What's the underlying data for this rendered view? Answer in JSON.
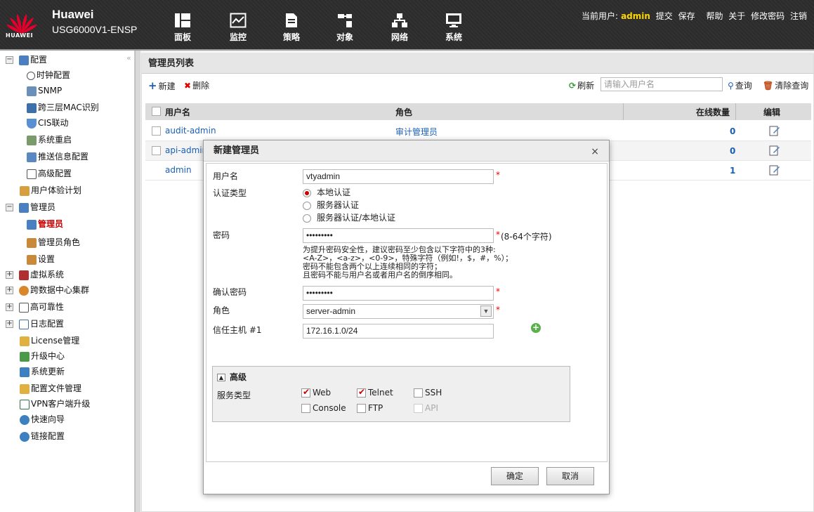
{
  "header": {
    "brand_name": "Huawei",
    "device_name": "USG6000V1-ENSP",
    "logo_text": "HUAWEI",
    "nav": [
      {
        "label": "面板",
        "icon": "dashboard-icon"
      },
      {
        "label": "监控",
        "icon": "monitor-chart-icon"
      },
      {
        "label": "策略",
        "icon": "policy-document-icon"
      },
      {
        "label": "对象",
        "icon": "object-icon"
      },
      {
        "label": "网络",
        "icon": "network-topology-icon"
      },
      {
        "label": "系统",
        "icon": "system-monitor-icon"
      }
    ],
    "active_nav": "系统",
    "current_user_label": "当前用户:",
    "current_user": "admin",
    "links": [
      "提交",
      "保存",
      "帮助",
      "关于",
      "修改密码",
      "注销"
    ]
  },
  "sidebar": {
    "items": [
      {
        "label": "配置",
        "toggle": "−"
      },
      {
        "label": "时钟配置"
      },
      {
        "label": "SNMP"
      },
      {
        "label": "跨三层MAC识别"
      },
      {
        "label": "CIS联动"
      },
      {
        "label": "系统重启"
      },
      {
        "label": "推送信息配置"
      },
      {
        "label": "高级配置"
      },
      {
        "label": "用户体验计划"
      },
      {
        "label": "管理员",
        "toggle": "−"
      },
      {
        "label": "管理员",
        "selected": true
      },
      {
        "label": "管理员角色"
      },
      {
        "label": "设置"
      },
      {
        "label": "虚拟系统",
        "toggle": "+"
      },
      {
        "label": "跨数据中心集群",
        "toggle": "+"
      },
      {
        "label": "高可靠性",
        "toggle": "+"
      },
      {
        "label": "日志配置",
        "toggle": "+"
      },
      {
        "label": "License管理"
      },
      {
        "label": "升级中心"
      },
      {
        "label": "系统更新"
      },
      {
        "label": "配置文件管理"
      },
      {
        "label": "VPN客户端升级"
      },
      {
        "label": "快速向导"
      },
      {
        "label": "链接配置"
      }
    ]
  },
  "main": {
    "title": "管理员列表",
    "toolbar": {
      "new_label": "新建",
      "delete_label": "删除",
      "refresh_label": "刷新",
      "search_placeholder": "请输入用户名",
      "query_label": "查询",
      "clear_label": "清除查询"
    },
    "columns": [
      "用户名",
      "角色",
      "在线数量",
      "编辑"
    ],
    "rows": [
      {
        "username": "audit-admin",
        "role": "审计管理员",
        "online": "0",
        "checkbox": true
      },
      {
        "username": "api-admin",
        "role": "",
        "online": "0",
        "checkbox": true
      },
      {
        "username": "admin",
        "role": "",
        "online": "1",
        "checkbox": false
      }
    ]
  },
  "dialog": {
    "title": "新建管理员",
    "close": "×",
    "username_label": "用户名",
    "username_value": "vtyadmin",
    "auth_label": "认证类型",
    "auth_options": [
      "本地认证",
      "服务器认证",
      "服务器认证/本地认证"
    ],
    "auth_selected": "本地认证",
    "password_label": "密码",
    "password_value": "•••••••••",
    "password_hint": "(8-64个字符)",
    "hint_lines": [
      "为提升密码安全性，建议密码至少包含以下字符中的3种:",
      "<A-Z>，<a-z>，<0-9>，特殊字符（例如!，$，#，%）；",
      "密码不能包含两个以上连续相同的字符；",
      "且密码不能与用户名或者用户名的倒序相同。"
    ],
    "confirm_label": "确认密码",
    "confirm_value": "•••••••••",
    "role_label": "角色",
    "role_value": "server-admin",
    "trust_label": "信任主机 #1",
    "trust_value": "172.16.1.0/24",
    "required_mark": "*",
    "advanced": {
      "label": "高级",
      "service_label": "服务类型",
      "services": [
        {
          "name": "Web",
          "checked": true,
          "disabled": false
        },
        {
          "name": "Telnet",
          "checked": true,
          "disabled": false
        },
        {
          "name": "SSH",
          "checked": false,
          "disabled": false
        },
        {
          "name": "Console",
          "checked": false,
          "disabled": false
        },
        {
          "name": "FTP",
          "checked": false,
          "disabled": false
        },
        {
          "name": "API",
          "checked": false,
          "disabled": true
        }
      ]
    },
    "ok_label": "确定",
    "cancel_label": "取消"
  },
  "colors": {
    "accent_red": "#cc0000",
    "link_blue": "#1a5fb4",
    "username_yellow": "#ffd700"
  }
}
